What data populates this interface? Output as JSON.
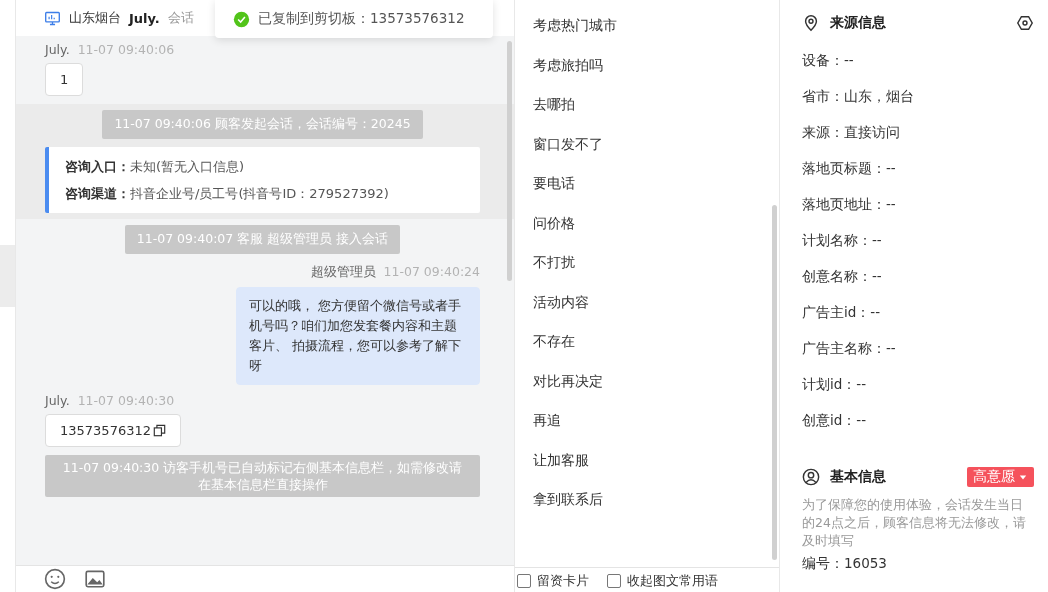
{
  "header": {
    "location": "山东烟台",
    "visitor": "July.",
    "status": "会话"
  },
  "toast": {
    "text": "已复制到剪切板：13573576312"
  },
  "messages": [
    {
      "kind": "visitor",
      "sender": "July.",
      "time": "11-07 09:40:06",
      "text": "1",
      "copyable": false
    },
    {
      "kind": "session",
      "notice": "11-07 09:40:06 顾客发起会话，会话编号：20245",
      "entry": [
        {
          "label": "咨询入口：",
          "value": "未知(暂无入口信息)"
        },
        {
          "label": "咨询渠道：",
          "value": "抖音企业号/员工号(抖音号ID：279527392)"
        }
      ]
    },
    {
      "kind": "system",
      "text": "11-07 09:40:07 客服 超级管理员 接入会话",
      "wide": false
    },
    {
      "kind": "agent",
      "sender": "超级管理员",
      "time": "11-07 09:40:24",
      "text": "可以的哦， 您方便留个微信号或者手机号吗？咱们加您发套餐内容和主题客片、 拍摄流程，您可以参考了解下呀"
    },
    {
      "kind": "visitor",
      "sender": "July.",
      "time": "11-07 09:40:30",
      "text": "13573576312",
      "copyable": true
    },
    {
      "kind": "system",
      "text": "11-07 09:40:30 访客手机号已自动标记右侧基本信息栏，如需修改请在基本信息栏直接操作",
      "wide": true
    }
  ],
  "phrases": [
    "考虑热门城市",
    "考虑旅拍吗",
    "去哪拍",
    "窗口发不了",
    "要电话",
    "问价格",
    "不打扰",
    "活动内容",
    "不存在",
    "对比再决定",
    "再追",
    "让加客服",
    "拿到联系后"
  ],
  "phrase_options": [
    {
      "label": "留资卡片",
      "checked": false
    },
    {
      "label": "收起图文常用语",
      "checked": false
    }
  ],
  "source": {
    "title": "来源信息",
    "fields": [
      "设备：--",
      "省市：山东，烟台",
      "来源：直接访问",
      "落地页标题：--",
      "落地页地址：--",
      "计划名称：--",
      "创意名称：--",
      "广告主id：--",
      "广告主名称：--",
      "计划id：--",
      "创意id：--"
    ]
  },
  "basic": {
    "title": "基本信息",
    "intent": {
      "label": "高意愿",
      "color": "#f5525c"
    },
    "note": "为了保障您的使用体验，会话发生当日的24点之后，顾客信息将无法修改，请及时填写",
    "fields": [
      "编号：16053"
    ]
  }
}
